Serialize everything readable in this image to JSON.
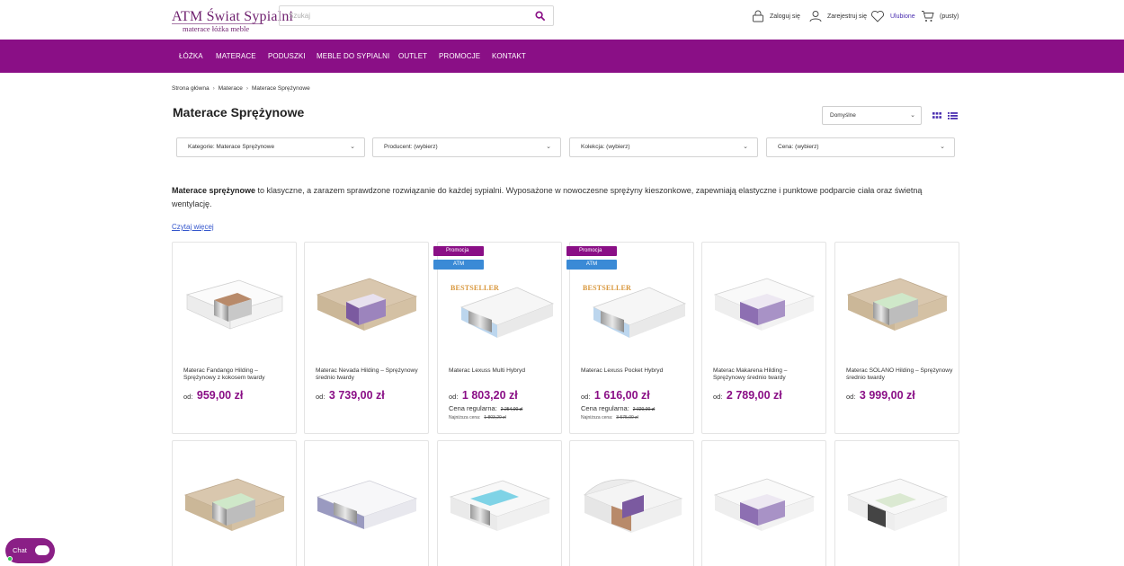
{
  "header": {
    "logo_title": "ATM Świat Sypialni",
    "logo_subtitle": "materace łóżka meble",
    "search_placeholder": "Szukaj",
    "login": "Zaloguj się",
    "register": "Zarejestruj się",
    "favorites": "Ulubione",
    "cart": "(pusty)"
  },
  "nav": [
    "ŁÓŻKA",
    "MATERACE",
    "PODUSZKI",
    "MEBLE DO SYPIALNI",
    "OUTLET",
    "PROMOCJE",
    "KONTAKT"
  ],
  "breadcrumb": [
    "Strona główna",
    "Materace",
    "Materace Sprężynowe"
  ],
  "page_title": "Materace Sprężynowe",
  "sort": {
    "selected": "Domyślne"
  },
  "filters": [
    "Kategorie: Materace Sprężynowe",
    "Producent: (wybierz)",
    "Kolekcja: (wybierz)",
    "Cena: (wybierz)"
  ],
  "intro": {
    "bold": "Materace sprężynowe",
    "text": " to klasyczne, a zarazem sprawdzone rozwiązanie do każdej sypialni. Wyposażone w nowoczesne sprężyny kieszonkowe, zapewniają elastyczne i punktowe podparcie ciała oraz świetną wentylację.",
    "read_more": "Czytaj więcej"
  },
  "products": [
    {
      "name": "Materac Fandango Hilding – Sprężynowy z kokosem twardy",
      "price_prefix": "od:",
      "price": "959,00 zł"
    },
    {
      "name": "Materac Nevada Hilding – Sprężynowy średnio twardy",
      "price_prefix": "od:",
      "price": "3 739,00 zł"
    },
    {
      "name": "Materac Lexuss Multi Hybryd",
      "price_prefix": "od:",
      "price": "1 803,20 zł",
      "badge_promo": "Promocja",
      "badge_brand": "ATM",
      "bestseller": "BESTSELLER",
      "regular_label": "Cena regularna:",
      "regular_price": "2 254,00 zł",
      "lowest_label": "Najniższa cena:",
      "lowest_price": "1 803,20 zł"
    },
    {
      "name": "Materac Lexuss Pocket Hybryd",
      "price_prefix": "od:",
      "price": "1 616,00 zł",
      "badge_promo": "Promocja",
      "badge_brand": "ATM",
      "bestseller": "BESTSELLER",
      "regular_label": "Cena regularna:",
      "regular_price": "2 020,00 zł",
      "lowest_label": "Najniższa cena:",
      "lowest_price": "3 575,00 zł"
    },
    {
      "name": "Materac Makarena Hilding – Sprężynowy średnio twardy",
      "price_prefix": "od:",
      "price": "2 789,00 zł"
    },
    {
      "name": "Materac SOLANO Hilding – Sprężynowy średnio twardy",
      "price_prefix": "od:",
      "price": "3 999,00 zł"
    }
  ],
  "chat": {
    "label": "Chat"
  },
  "colors": {
    "brand_purple": "#8a0f86",
    "badge_blue": "#3a8ad6",
    "link_blue": "#3355cc"
  }
}
